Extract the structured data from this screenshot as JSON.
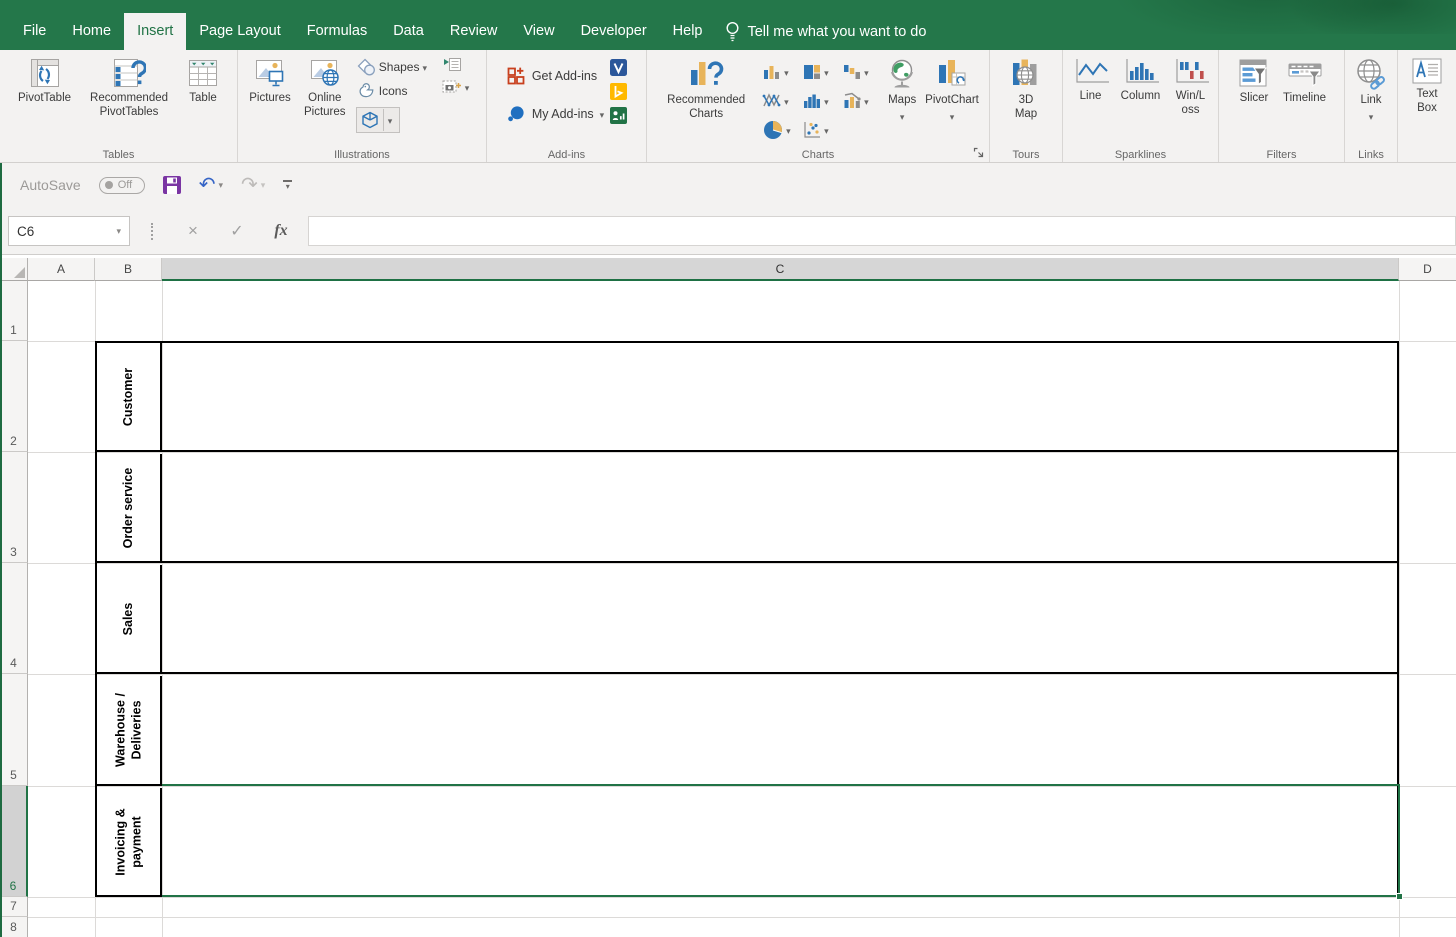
{
  "titlebar": {
    "tabs": [
      {
        "label": "File"
      },
      {
        "label": "Home"
      },
      {
        "label": "Insert"
      },
      {
        "label": "Page Layout"
      },
      {
        "label": "Formulas"
      },
      {
        "label": "Data"
      },
      {
        "label": "Review"
      },
      {
        "label": "View"
      },
      {
        "label": "Developer"
      },
      {
        "label": "Help"
      }
    ],
    "active_tab": "Insert",
    "tell_me": "Tell me what you want to do"
  },
  "ribbon": {
    "tables": {
      "group_label": "Tables",
      "pivottable": "PivotTable",
      "recommended_pivottables": "Recommended PivotTables",
      "table": "Table"
    },
    "illustrations": {
      "group_label": "Illustrations",
      "pictures": "Pictures",
      "online_pictures": "Online Pictures",
      "shapes": "Shapes",
      "icons": "Icons"
    },
    "addins": {
      "group_label": "Add-ins",
      "get_addins": "Get Add-ins",
      "my_addins": "My Add-ins"
    },
    "charts": {
      "group_label": "Charts",
      "recommended_charts": "Recommended Charts",
      "maps": "Maps",
      "pivotchart": "PivotChart",
      "mini_buttons": [
        "insert-column-or-bar-chart-icon",
        "insert-hierarchy-chart-icon",
        "insert-waterfall-or-stock-chart-icon",
        "insert-line-or-area-chart-icon",
        "insert-statistic-chart-icon",
        "insert-combo-chart-icon",
        "insert-pie-or-doughnut-chart-icon",
        "insert-scatter-or-bubble-chart-icon"
      ]
    },
    "tours": {
      "group_label": "Tours",
      "map3d": "3D Map"
    },
    "sparklines": {
      "group_label": "Sparklines",
      "line": "Line",
      "column": "Column",
      "winloss": "Win/Loss"
    },
    "filters": {
      "group_label": "Filters",
      "slicer": "Slicer",
      "timeline": "Timeline"
    },
    "links": {
      "group_label": "Links",
      "link": "Link"
    },
    "text": {
      "textbox": "Text Box"
    }
  },
  "qat": {
    "autosave": "AutoSave",
    "autosave_state": "Off",
    "icons": [
      "save-icon",
      "undo-icon",
      "redo-icon",
      "customize-qat-icon"
    ]
  },
  "formula_bar": {
    "name_box": "C6",
    "fx": "fx",
    "formula": "",
    "icons": [
      "cancel-icon",
      "enter-icon",
      "insert-function-icon"
    ]
  },
  "sheet": {
    "column_headers": [
      "A",
      "B",
      "C",
      "D"
    ],
    "row_headers": [
      "1",
      "2",
      "3",
      "4",
      "5",
      "6",
      "7",
      "8"
    ],
    "active_cell": "C6",
    "selected_column": "C",
    "selected_row": "6",
    "swimlanes": [
      {
        "label": "Customer"
      },
      {
        "label": "Order service"
      },
      {
        "label": "Sales"
      },
      {
        "label": "Warehouse /\nDeliveries"
      },
      {
        "label": "Invoicing &\npayment"
      }
    ]
  },
  "colors": {
    "accent_green": "#217346",
    "selection_green": "#217346",
    "table_border": "#000000",
    "save_icon_purple": "#7a35a3",
    "undo_blue": "#3665c6",
    "get_addins_red": "#c8401e",
    "bing_yellow": "#ffb900",
    "chart_blue": "#2e75b5",
    "chart_tan": "#e8b45a",
    "chart_gray": "#8c8c8c"
  }
}
